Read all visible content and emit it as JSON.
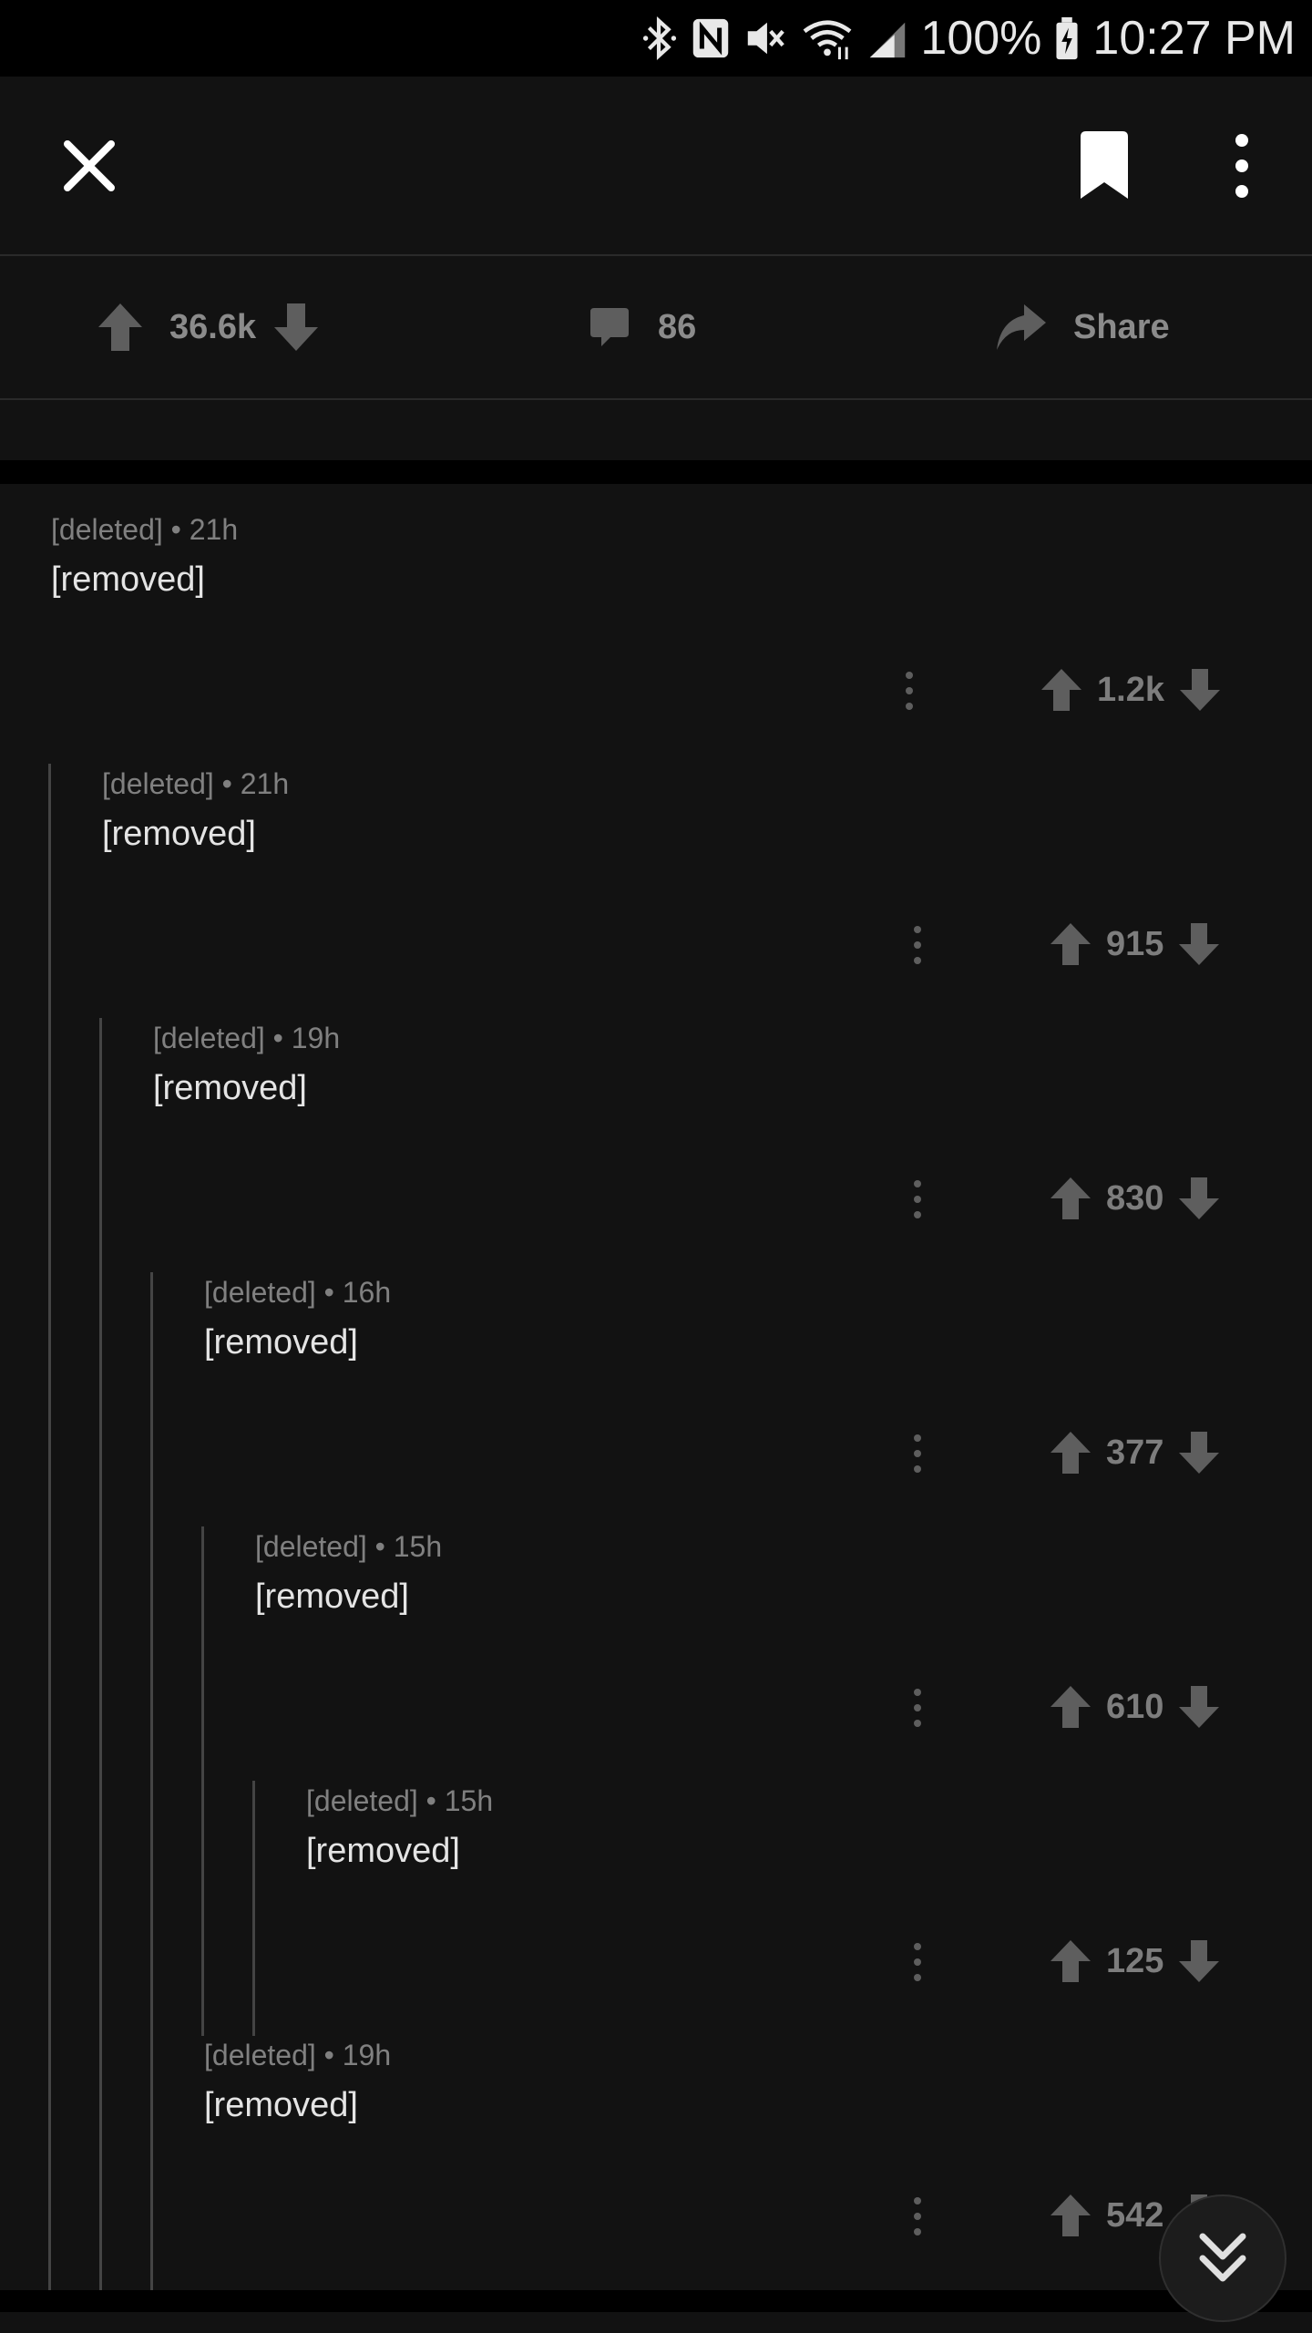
{
  "status_bar": {
    "battery": "100%",
    "time": "10:27 PM"
  },
  "toolbar": {
    "close_icon": "close-icon",
    "save_icon": "bookmark-icon",
    "more_icon": "more-vertical-icon"
  },
  "post_actions": {
    "score": "36.6k",
    "comments": "86",
    "share_label": "Share"
  },
  "comments": [
    {
      "depth": 0,
      "author": "[deleted]",
      "separator": "•",
      "age": "21h",
      "body": "[removed]",
      "score": "1.2k"
    },
    {
      "depth": 1,
      "author": "[deleted]",
      "separator": "•",
      "age": "21h",
      "body": "[removed]",
      "score": "915"
    },
    {
      "depth": 2,
      "author": "[deleted]",
      "separator": "•",
      "age": "19h",
      "body": "[removed]",
      "score": "830"
    },
    {
      "depth": 3,
      "author": "[deleted]",
      "separator": "•",
      "age": "16h",
      "body": "[removed]",
      "score": "377"
    },
    {
      "depth": 4,
      "author": "[deleted]",
      "separator": "•",
      "age": "15h",
      "body": "[removed]",
      "score": "610"
    },
    {
      "depth": 5,
      "author": "[deleted]",
      "separator": "•",
      "age": "15h",
      "body": "[removed]",
      "score": "125"
    },
    {
      "depth": 3,
      "author": "[deleted]",
      "separator": "•",
      "age": "19h",
      "body": "[removed]",
      "score": "542"
    }
  ],
  "colors": {
    "background": "#121212",
    "text": "#e4e4e4",
    "muted": "#808080",
    "icon": "#5e5e5e"
  }
}
